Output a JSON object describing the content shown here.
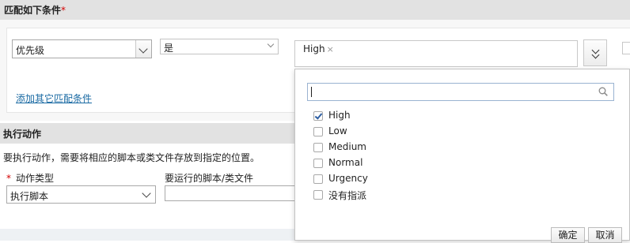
{
  "conditions": {
    "title": "匹配如下条件",
    "required_mark": "*",
    "field_select": "优先级",
    "operator_select": "是",
    "selected_chip": "High",
    "chip_remove": "×",
    "add_condition_link": "添加其它匹配条件"
  },
  "actions": {
    "title": "执行动作",
    "description": "要执行动作，需要将相应的脚本或类文件存放到指定的位置。",
    "required_mark": "*",
    "type_label": "动作类型",
    "type_select": "执行脚本",
    "script_label": "要运行的脚本/类文件"
  },
  "dropdown": {
    "search_value": "",
    "options": [
      {
        "label": "High",
        "checked": true
      },
      {
        "label": "Low",
        "checked": false
      },
      {
        "label": "Medium",
        "checked": false
      },
      {
        "label": "Normal",
        "checked": false
      },
      {
        "label": "Urgency",
        "checked": false
      },
      {
        "label": "没有指派",
        "checked": false
      }
    ],
    "ok_label": "确定",
    "cancel_label": "取消"
  },
  "colors": {
    "header_bg": "#e2e2e2",
    "link": "#1a6aa3",
    "required": "#d40000",
    "check": "#2e5fa3"
  }
}
